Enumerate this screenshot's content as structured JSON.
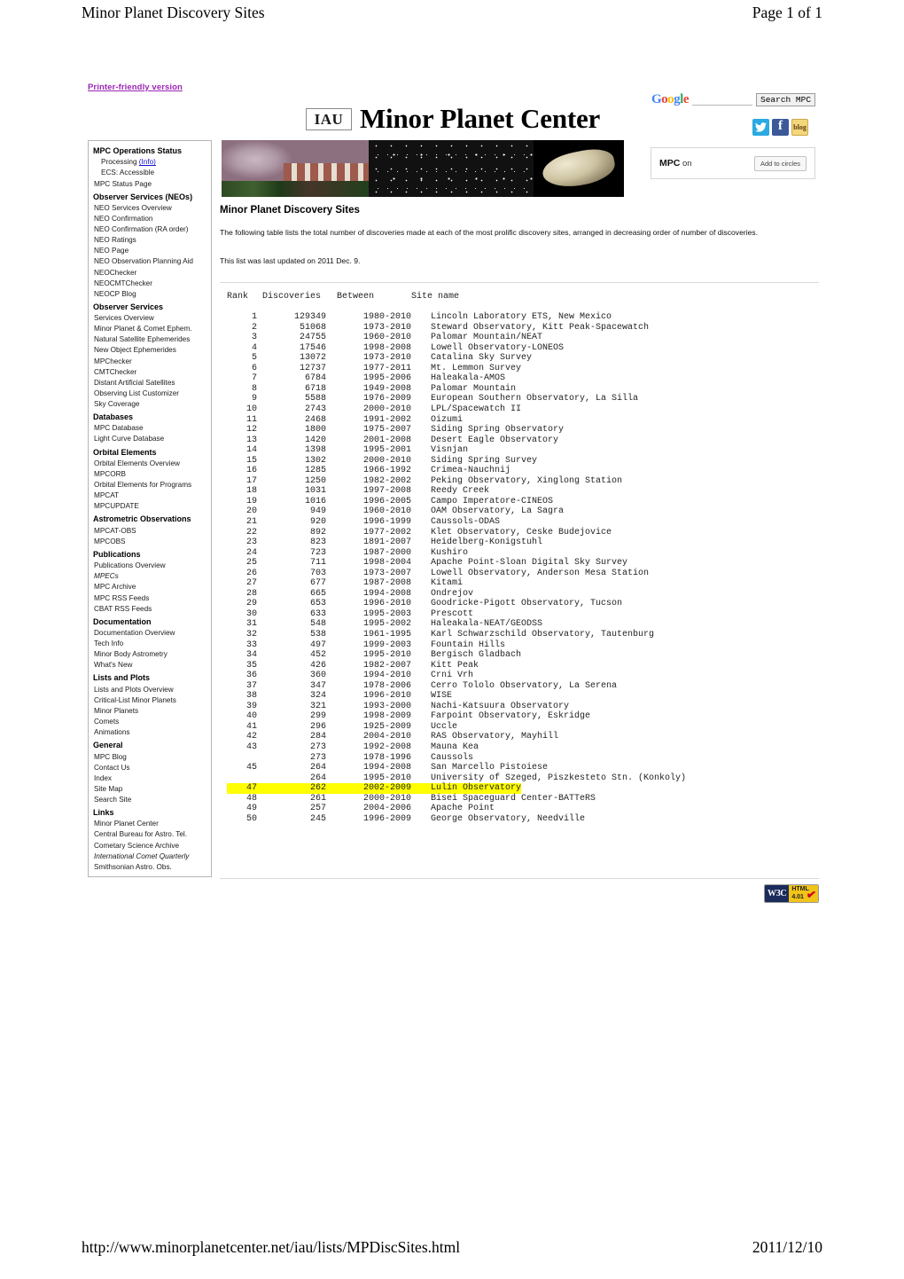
{
  "print": {
    "header_title": "Minor Planet Discovery Sites",
    "header_page": "Page 1 of 1",
    "footer_url": "http://www.minorplanetcenter.net/iau/lists/MPDiscSites.html",
    "footer_date": "2011/12/10"
  },
  "printer_friendly_label": "Printer-friendly version",
  "search": {
    "google_logo": "Google",
    "input_value": "",
    "placeholder": "",
    "button_label": "Search MPC"
  },
  "social": {
    "twitter": "twitter-icon",
    "facebook": "facebook-icon",
    "blog_label": "blog"
  },
  "gplus": {
    "prefix": "MPC",
    "suffix": "on",
    "button_label": "Add to circles"
  },
  "banner": {
    "iau_label": "IAU",
    "wordmark": "Minor Planet Center",
    "images": [
      "observatory-photo",
      "star-field-photo",
      "asteroid-photo"
    ]
  },
  "sidebar": {
    "sections": [
      {
        "heading": "MPC Operations Status",
        "items": [
          {
            "label": "Processing",
            "link": "(Info)",
            "indent": true
          },
          {
            "label": "ECS: Accessible",
            "indent": true
          },
          {
            "label": "MPC Status Page"
          }
        ]
      },
      {
        "heading": "Observer Services (NEOs)",
        "items": [
          {
            "label": "NEO Services Overview"
          },
          {
            "label": "NEO Confirmation"
          },
          {
            "label": "NEO Confirmation (RA order)"
          },
          {
            "label": "NEO Ratings"
          },
          {
            "label": "NEO Page"
          },
          {
            "label": "NEO Observation Planning Aid"
          },
          {
            "label": "NEOChecker"
          },
          {
            "label": "NEOCMTChecker"
          },
          {
            "label": "NEOCP Blog"
          }
        ]
      },
      {
        "heading": "Observer Services",
        "items": [
          {
            "label": "Services Overview"
          },
          {
            "label": "Minor Planet & Comet Ephem."
          },
          {
            "label": "Natural Satellite Ephemerides"
          },
          {
            "label": "New Object Ephemerides"
          },
          {
            "label": "MPChecker"
          },
          {
            "label": "CMTChecker"
          },
          {
            "label": "Distant Artificial Satellites"
          },
          {
            "label": "Observing List Customizer"
          },
          {
            "label": "Sky Coverage"
          }
        ]
      },
      {
        "heading": "Databases",
        "items": [
          {
            "label": "MPC Database"
          },
          {
            "label": "Light Curve Database"
          }
        ]
      },
      {
        "heading": "Orbital Elements",
        "items": [
          {
            "label": "Orbital Elements Overview"
          },
          {
            "label": "MPCORB"
          },
          {
            "label": "Orbital Elements for Programs"
          },
          {
            "label": "MPCAT"
          },
          {
            "label": "MPCUPDATE"
          }
        ]
      },
      {
        "heading": "Astrometric Observations",
        "items": [
          {
            "label": "MPCAT-OBS"
          },
          {
            "label": "MPCOBS"
          }
        ]
      },
      {
        "heading": "Publications",
        "items": [
          {
            "label": "Publications Overview"
          },
          {
            "label": "MPECs",
            "italic": true
          },
          {
            "label": "MPC Archive"
          },
          {
            "label": "MPC RSS Feeds"
          },
          {
            "label": "CBAT RSS Feeds"
          }
        ]
      },
      {
        "heading": "Documentation",
        "items": [
          {
            "label": "Documentation Overview"
          },
          {
            "label": "Tech Info"
          },
          {
            "label": "Minor Body Astrometry"
          },
          {
            "label": "What's New"
          }
        ]
      },
      {
        "heading": "Lists and Plots",
        "items": [
          {
            "label": "Lists and Plots Overview"
          },
          {
            "label": "Critical-List Minor Planets"
          },
          {
            "label": "Minor Planets"
          },
          {
            "label": "Comets"
          },
          {
            "label": "Animations"
          }
        ]
      },
      {
        "heading": "General",
        "items": [
          {
            "label": "MPC Blog"
          },
          {
            "label": "Contact Us"
          },
          {
            "label": "Index"
          },
          {
            "label": "Site Map"
          },
          {
            "label": "Search Site"
          }
        ]
      },
      {
        "heading": "Links",
        "items": [
          {
            "label": "Minor Planet Center"
          },
          {
            "label": "Central Bureau for Astro. Tel."
          },
          {
            "label": "Cometary Science Archive"
          },
          {
            "label": "International Comet Quarterly",
            "italic": true
          },
          {
            "label": "Smithsonian Astro. Obs."
          }
        ]
      }
    ]
  },
  "main": {
    "title": "Minor Planet Discovery Sites",
    "intro": "The following table lists the total number of discoveries made at each of the most prolific discovery sites, arranged in decreasing order of number of discoveries.",
    "updated": "This list was last updated on 2011 Dec. 9."
  },
  "table": {
    "columns": [
      "Rank",
      "Discoveries",
      "Between",
      "Site name"
    ],
    "highlight_color": "#ffff00",
    "rows": [
      {
        "rank": "1",
        "discoveries": "129349",
        "between": "1980-2010",
        "site": "Lincoln Laboratory ETS, New Mexico"
      },
      {
        "rank": "2",
        "discoveries": "51068",
        "between": "1973-2010",
        "site": "Steward Observatory, Kitt Peak-Spacewatch"
      },
      {
        "rank": "3",
        "discoveries": "24755",
        "between": "1960-2010",
        "site": "Palomar Mountain/NEAT"
      },
      {
        "rank": "4",
        "discoveries": "17546",
        "between": "1998-2008",
        "site": "Lowell Observatory-LONEOS"
      },
      {
        "rank": "5",
        "discoveries": "13072",
        "between": "1973-2010",
        "site": "Catalina Sky Survey"
      },
      {
        "rank": "6",
        "discoveries": "12737",
        "between": "1977-2011",
        "site": "Mt. Lemmon Survey"
      },
      {
        "rank": "7",
        "discoveries": "6784",
        "between": "1995-2006",
        "site": "Haleakala-AMOS"
      },
      {
        "rank": "8",
        "discoveries": "6718",
        "between": "1949-2008",
        "site": "Palomar Mountain"
      },
      {
        "rank": "9",
        "discoveries": "5588",
        "between": "1976-2009",
        "site": "European Southern Observatory, La Silla"
      },
      {
        "rank": "10",
        "discoveries": "2743",
        "between": "2000-2010",
        "site": "LPL/Spacewatch II"
      },
      {
        "rank": "11",
        "discoveries": "2468",
        "between": "1991-2002",
        "site": "Oizumi"
      },
      {
        "rank": "12",
        "discoveries": "1800",
        "between": "1975-2007",
        "site": "Siding Spring Observatory"
      },
      {
        "rank": "13",
        "discoveries": "1420",
        "between": "2001-2008",
        "site": "Desert Eagle Observatory"
      },
      {
        "rank": "14",
        "discoveries": "1398",
        "between": "1995-2001",
        "site": "Visnjan"
      },
      {
        "rank": "15",
        "discoveries": "1302",
        "between": "2000-2010",
        "site": "Siding Spring Survey"
      },
      {
        "rank": "16",
        "discoveries": "1285",
        "between": "1966-1992",
        "site": "Crimea-Nauchnij"
      },
      {
        "rank": "17",
        "discoveries": "1250",
        "between": "1982-2002",
        "site": "Peking Observatory, Xinglong Station"
      },
      {
        "rank": "18",
        "discoveries": "1031",
        "between": "1997-2008",
        "site": "Reedy Creek"
      },
      {
        "rank": "19",
        "discoveries": "1016",
        "between": "1996-2005",
        "site": "Campo Imperatore-CINEOS"
      },
      {
        "rank": "20",
        "discoveries": "949",
        "between": "1960-2010",
        "site": "OAM Observatory, La Sagra"
      },
      {
        "rank": "21",
        "discoveries": "920",
        "between": "1996-1999",
        "site": "Caussols-ODAS"
      },
      {
        "rank": "22",
        "discoveries": "892",
        "between": "1977-2002",
        "site": "Klet Observatory, Ceske Budejovice"
      },
      {
        "rank": "23",
        "discoveries": "823",
        "between": "1891-2007",
        "site": "Heidelberg-Konigstuhl"
      },
      {
        "rank": "24",
        "discoveries": "723",
        "between": "1987-2000",
        "site": "Kushiro"
      },
      {
        "rank": "25",
        "discoveries": "711",
        "between": "1998-2004",
        "site": "Apache Point-Sloan Digital Sky Survey"
      },
      {
        "rank": "26",
        "discoveries": "703",
        "between": "1973-2007",
        "site": "Lowell Observatory, Anderson Mesa Station"
      },
      {
        "rank": "27",
        "discoveries": "677",
        "between": "1987-2008",
        "site": "Kitami"
      },
      {
        "rank": "28",
        "discoveries": "665",
        "between": "1994-2008",
        "site": "Ondrejov"
      },
      {
        "rank": "29",
        "discoveries": "653",
        "between": "1996-2010",
        "site": "Goodricke-Pigott Observatory, Tucson"
      },
      {
        "rank": "30",
        "discoveries": "633",
        "between": "1995-2003",
        "site": "Prescott"
      },
      {
        "rank": "31",
        "discoveries": "548",
        "between": "1995-2002",
        "site": "Haleakala-NEAT/GEODSS"
      },
      {
        "rank": "32",
        "discoveries": "538",
        "between": "1961-1995",
        "site": "Karl Schwarzschild Observatory, Tautenburg"
      },
      {
        "rank": "33",
        "discoveries": "497",
        "between": "1999-2003",
        "site": "Fountain Hills"
      },
      {
        "rank": "34",
        "discoveries": "452",
        "between": "1995-2010",
        "site": "Bergisch Gladbach"
      },
      {
        "rank": "35",
        "discoveries": "426",
        "between": "1982-2007",
        "site": "Kitt Peak"
      },
      {
        "rank": "36",
        "discoveries": "360",
        "between": "1994-2010",
        "site": "Crni Vrh"
      },
      {
        "rank": "37",
        "discoveries": "347",
        "between": "1978-2006",
        "site": "Cerro Tololo Observatory, La Serena"
      },
      {
        "rank": "38",
        "discoveries": "324",
        "between": "1996-2010",
        "site": "WISE"
      },
      {
        "rank": "39",
        "discoveries": "321",
        "between": "1993-2000",
        "site": "Nachi-Katsuura Observatory"
      },
      {
        "rank": "40",
        "discoveries": "299",
        "between": "1998-2009",
        "site": "Farpoint Observatory, Eskridge"
      },
      {
        "rank": "41",
        "discoveries": "296",
        "between": "1925-2009",
        "site": "Uccle"
      },
      {
        "rank": "42",
        "discoveries": "284",
        "between": "2004-2010",
        "site": "RAS Observatory, Mayhill"
      },
      {
        "rank": "43",
        "discoveries": "273",
        "between": "1992-2008",
        "site": "Mauna Kea"
      },
      {
        "rank": "",
        "discoveries": "273",
        "between": "1978-1996",
        "site": "Caussols"
      },
      {
        "rank": "45",
        "discoveries": "264",
        "between": "1994-2008",
        "site": "San Marcello Pistoiese"
      },
      {
        "rank": "",
        "discoveries": "264",
        "between": "1995-2010",
        "site": "University of Szeged, Piszkesteto Stn. (Konkoly)"
      },
      {
        "rank": "47",
        "discoveries": "262",
        "between": "2002-2009",
        "site": "Lulin Observatory",
        "highlight": true
      },
      {
        "rank": "48",
        "discoveries": "261",
        "between": "2000-2010",
        "site": "Bisei Spaceguard Center-BATTeRS"
      },
      {
        "rank": "49",
        "discoveries": "257",
        "between": "2004-2006",
        "site": "Apache Point"
      },
      {
        "rank": "50",
        "discoveries": "245",
        "between": "1996-2009",
        "site": "George Observatory, Needville"
      }
    ]
  },
  "w3c_badge": {
    "left": "W3C",
    "line1": "HTML",
    "line2": "4.01"
  }
}
